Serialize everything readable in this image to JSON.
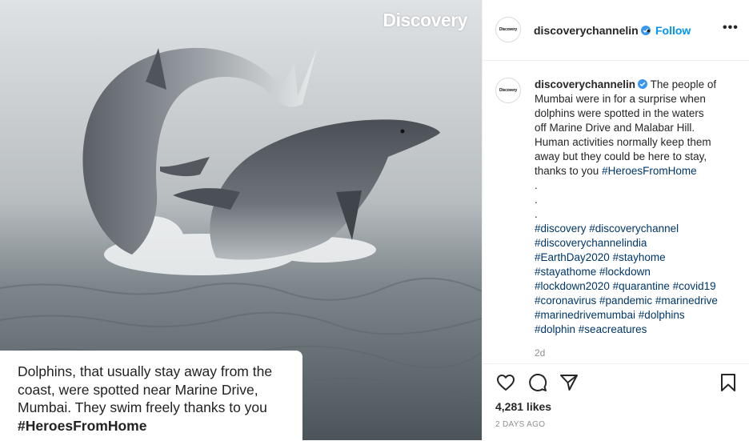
{
  "photo": {
    "brand": "Discovery",
    "caption_lines": [
      "Dolphins, that usually stay away from the",
      "coast, were spotted near Marine Drive,",
      "Mumbai. They swim freely thanks to you"
    ],
    "caption_tag": "#HeroesFromHome"
  },
  "header": {
    "avatar_text": "Discovery",
    "username": "discoverychannelin",
    "separator": "•",
    "follow": "Follow",
    "more": "•••"
  },
  "post": {
    "username": "discoverychannelin",
    "avatar_text": "Discovery",
    "lines": [
      "The people of",
      "Mumbai were in for a surprise when",
      "dolphins were spotted in the waters",
      "off Marine Drive and Malabar Hill.",
      "Human activities normally keep them",
      "away but they could be here to stay,",
      "thanks to you "
    ],
    "inline_tag": "#HeroesFromHome",
    "dots": [
      ".",
      ".",
      "."
    ],
    "hashtag_lines": [
      "#discovery #discoverychannel",
      "#discoverychannelindia",
      "#EarthDay2020 #stayhome",
      "#stayathome #lockdown",
      "#lockdown2020 #quarantine #covid19",
      "#coronavirus #pandemic #marinedrive",
      "#marinedrivemumbai #dolphins",
      "#dolphin #seacreatures"
    ],
    "age": "2d"
  },
  "actions": {
    "likes": "4,281 likes",
    "timestamp": "2 DAYS AGO"
  },
  "colors": {
    "link": "#00376b",
    "follow": "#0095f6",
    "verified": "#3897f0",
    "muted": "#8e8e8e"
  },
  "icons": [
    "heart-icon",
    "comment-icon",
    "share-icon",
    "bookmark-icon",
    "verified-icon"
  ]
}
